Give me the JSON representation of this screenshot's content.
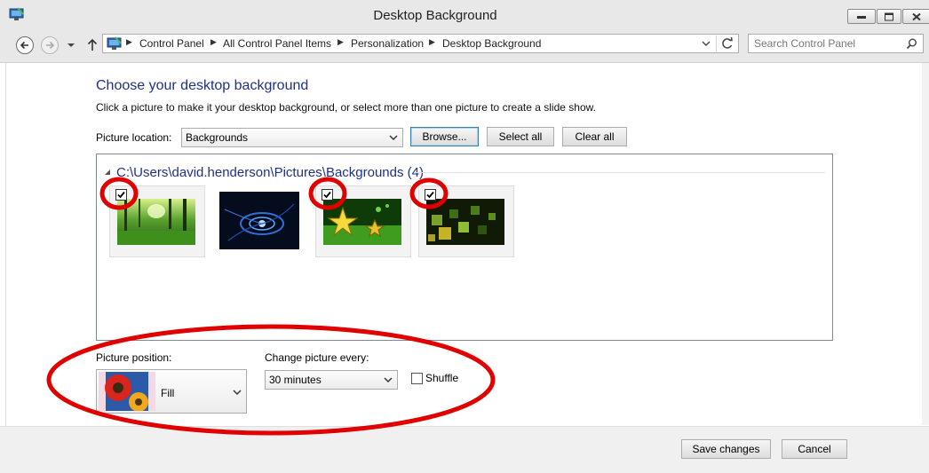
{
  "window": {
    "title": "Desktop Background"
  },
  "address_bar": {
    "crumbs": [
      "Control Panel",
      "All Control Panel Items",
      "Personalization",
      "Desktop Background"
    ],
    "search_placeholder": "Search Control Panel"
  },
  "main": {
    "heading": "Choose your desktop background",
    "subtitle": "Click a picture to make it your desktop background, or select more than one picture to create a slide show.",
    "picture_location": {
      "label": "Picture location:",
      "value": "Backgrounds"
    },
    "browse_label": "Browse...",
    "select_all_label": "Select all",
    "clear_all_label": "Clear all",
    "group_header": "C:\\Users\\david.henderson\\Pictures\\Backgrounds (4)",
    "thumbnails": [
      {
        "name": "green forest",
        "checked": true
      },
      {
        "name": "blue fractal",
        "checked": false
      },
      {
        "name": "green star",
        "checked": true
      },
      {
        "name": "green cubes",
        "checked": true
      }
    ],
    "picture_position": {
      "label": "Picture position:",
      "value": "Fill"
    },
    "change_interval": {
      "label": "Change picture every:",
      "value": "30 minutes"
    },
    "shuffle": {
      "label": "Shuffle",
      "checked": false
    }
  },
  "footer": {
    "save_label": "Save changes",
    "cancel_label": "Cancel"
  },
  "colors": {
    "heading": "#1e3287",
    "annotation": "#e00000"
  }
}
